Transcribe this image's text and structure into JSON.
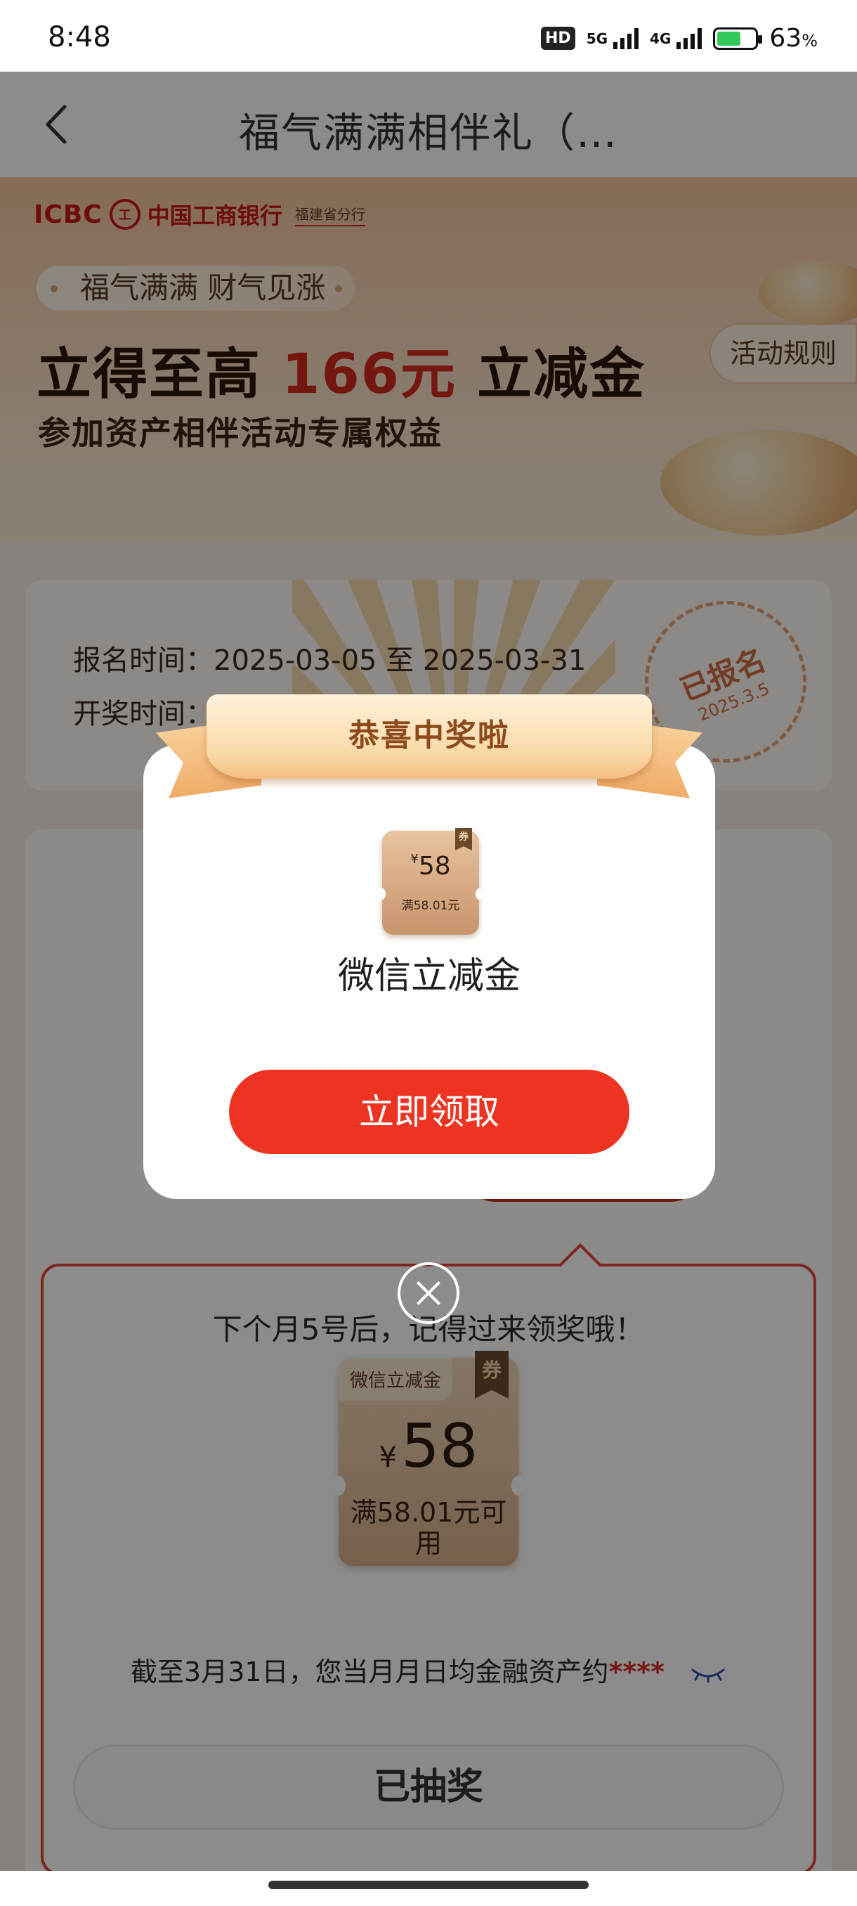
{
  "status_bar": {
    "time": "8:48",
    "hd_label": "HD",
    "net1": "5G",
    "net2": "4G",
    "battery_percent": "63",
    "battery_unit": "%",
    "battery_level": 0.63
  },
  "nav": {
    "title": "福气满满相伴礼（…",
    "back_icon": "chevron-left-icon"
  },
  "banner": {
    "bank_en": "ICBC",
    "bank_logo_text": "工",
    "bank_cn": "中国工商银行",
    "branch": "福建省分行",
    "slogan": "福气满满 财气见涨",
    "headline_prefix": "立得至高",
    "headline_amount": "166元",
    "headline_suffix": "立减金",
    "subheadline": "参加资产相伴活动专属权益",
    "rules_button": "活动规则"
  },
  "info_card": {
    "signup_label": "报名时间：",
    "signup_value": "2025-03-05 至 2025-03-31",
    "draw_label": "开奖时间：",
    "stamp_title": "已报名",
    "stamp_date": "2025.3.5"
  },
  "prize_section": {
    "next_month_text": "下个月5号后，记得过来领奖哦！",
    "coupon_title": "微信立减金",
    "coupon_tag": "券",
    "coupon_currency": "¥",
    "coupon_value": "58",
    "coupon_condition": "满58.01元可用",
    "asset_text": "截至3月31日，您当月月日均金融资产约",
    "asset_masked": "****",
    "drawn_button": "已抽奖"
  },
  "modal": {
    "ribbon_title": "恭喜中奖啦",
    "coupon_tag": "券",
    "coupon_currency": "¥",
    "coupon_value": "58",
    "coupon_condition": "满58.01元",
    "prize_name": "微信立减金",
    "claim_button": "立即领取",
    "close_icon": "close-circle-icon"
  },
  "colors": {
    "brand_red": "#c8161d",
    "claim_button": "#ed3423",
    "ribbon": "#fbd9a7",
    "amount_red": "#d22a1e"
  }
}
